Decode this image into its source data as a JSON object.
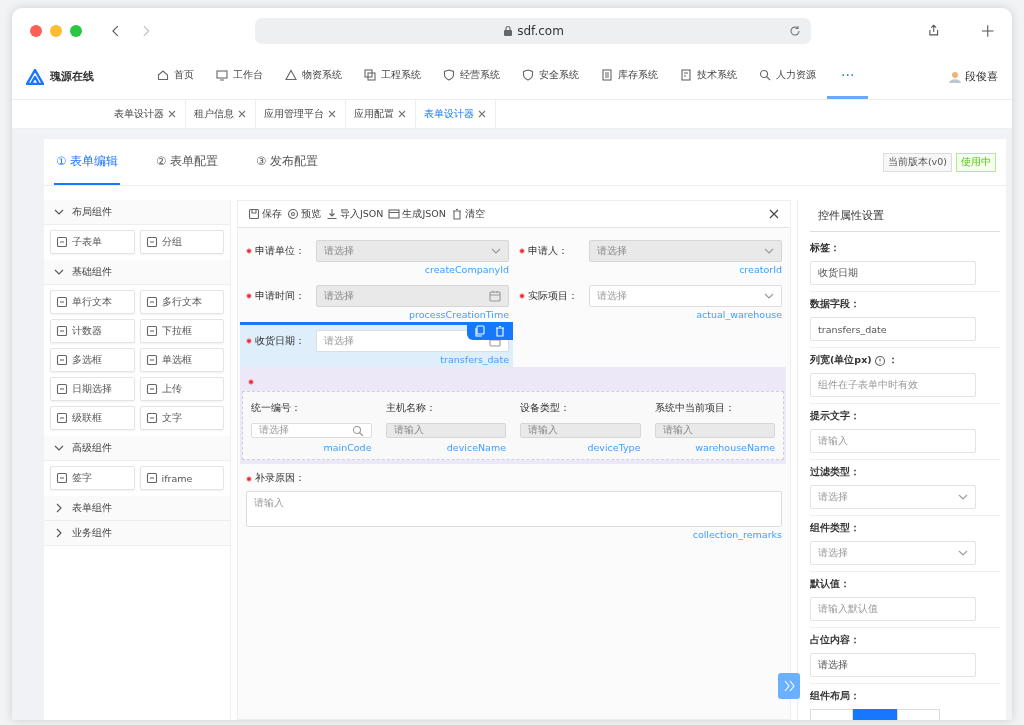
{
  "browser": {
    "url": "sdf.com"
  },
  "app": {
    "logo": "瑰源在线",
    "nav": [
      {
        "label": "首页",
        "selected": false
      },
      {
        "label": "工作台",
        "selected": false
      },
      {
        "label": "物资系统",
        "selected": false
      },
      {
        "label": "工程系统",
        "selected": false
      },
      {
        "label": "经营系统",
        "selected": false
      },
      {
        "label": "安全系统",
        "selected": false
      },
      {
        "label": "库存系统",
        "selected": false
      },
      {
        "label": "技术系统",
        "selected": false
      },
      {
        "label": "人力资源",
        "selected": false
      },
      {
        "label": "···",
        "selected": true
      }
    ],
    "user": "段俊喜"
  },
  "page_tabs": [
    {
      "label": "表单设计器",
      "selected": false
    },
    {
      "label": "租户信息",
      "selected": false
    },
    {
      "label": "应用管理平台",
      "selected": false
    },
    {
      "label": "应用配置",
      "selected": false
    },
    {
      "label": "表单设计器",
      "selected": true
    }
  ],
  "steps": [
    {
      "label": "① 表单编辑",
      "selected": true
    },
    {
      "label": "② 表单配置",
      "selected": false
    },
    {
      "label": "③ 发布配置",
      "selected": false
    }
  ],
  "version": "当前版本(v0)",
  "status": "使用中",
  "palette": [
    {
      "title": "布局组件",
      "expanded": true,
      "items": [
        "子表单",
        "分组"
      ]
    },
    {
      "title": "基础组件",
      "expanded": true,
      "items": [
        "单行文本",
        "多行文本",
        "计数器",
        "下拉框",
        "多选框",
        "单选框",
        "日期选择",
        "上传",
        "级联框",
        "文字"
      ]
    },
    {
      "title": "高级组件",
      "expanded": true,
      "items": [
        "签字",
        "iframe"
      ]
    },
    {
      "title": "表单组件",
      "expanded": false
    },
    {
      "title": "业务组件",
      "expanded": false
    }
  ],
  "toolbar": [
    "保存",
    "预览",
    "导入JSON",
    "生成JSON",
    "清空"
  ],
  "form": [
    {
      "kind": "select",
      "label": "申请单位：",
      "required": true,
      "placeholder": "请选择",
      "disabled": true,
      "field": "createCompanyId",
      "selected": false
    },
    {
      "kind": "select",
      "label": "申请人：",
      "required": true,
      "placeholder": "请选择",
      "disabled": true,
      "field": "creatorId",
      "selected": false
    },
    {
      "kind": "date",
      "label": "申请时间：",
      "required": true,
      "placeholder": "请选择",
      "disabled": true,
      "field": "processCreationTime",
      "selected": false
    },
    {
      "kind": "select",
      "label": "实际项目：",
      "required": true,
      "placeholder": "请选择",
      "disabled": false,
      "field": "actual_warehouse",
      "selected": false
    },
    {
      "kind": "date",
      "label": "收货日期：",
      "required": true,
      "placeholder": "请选择",
      "disabled": false,
      "field": "transfers_date",
      "selected": true
    },
    {
      "kind": "subform",
      "required": true,
      "selected": false,
      "columns": [
        {
          "kind": "search",
          "label": "统一编号：",
          "placeholder": "请选择",
          "disabled": false,
          "field": "mainCode"
        },
        {
          "kind": "input",
          "label": "主机名称：",
          "placeholder": "请输入",
          "disabled": true,
          "field": "deviceName"
        },
        {
          "kind": "input",
          "label": "设备类型：",
          "placeholder": "请输入",
          "disabled": true,
          "field": "deviceType"
        },
        {
          "kind": "input",
          "label": "系统中当前项目：",
          "placeholder": "请输入",
          "disabled": true,
          "field": "warehouseName"
        }
      ]
    },
    {
      "kind": "textarea",
      "label": "补录原因：",
      "required": true,
      "placeholder": "请输入",
      "disabled": false,
      "field": "collection_remarks",
      "selected": false
    }
  ],
  "properties": {
    "title": "控件属性设置",
    "items": [
      {
        "kind": "input",
        "label": "标签：",
        "value": "收货日期"
      },
      {
        "kind": "input",
        "label": "数据字段：",
        "value": "transfers_date"
      },
      {
        "kind": "input",
        "label": "列宽(单位px)",
        "help": true,
        "suffix": "：",
        "placeholder": "组件在子表单中时有效"
      },
      {
        "kind": "input",
        "label": "提示文字：",
        "placeholder": "请输入"
      },
      {
        "kind": "select",
        "label": "过滤类型：",
        "placeholder": "请选择"
      },
      {
        "kind": "select",
        "label": "组件类型：",
        "placeholder": "请选择"
      },
      {
        "kind": "input",
        "label": "默认值：",
        "placeholder": "请输入默认值"
      },
      {
        "kind": "input",
        "label": "占位内容：",
        "value": "请选择"
      },
      {
        "kind": "segmented",
        "label": "组件布局：",
        "segments": [
          {
            "selected": false
          },
          {
            "selected": true
          },
          {
            "selected": false
          }
        ]
      }
    ]
  }
}
